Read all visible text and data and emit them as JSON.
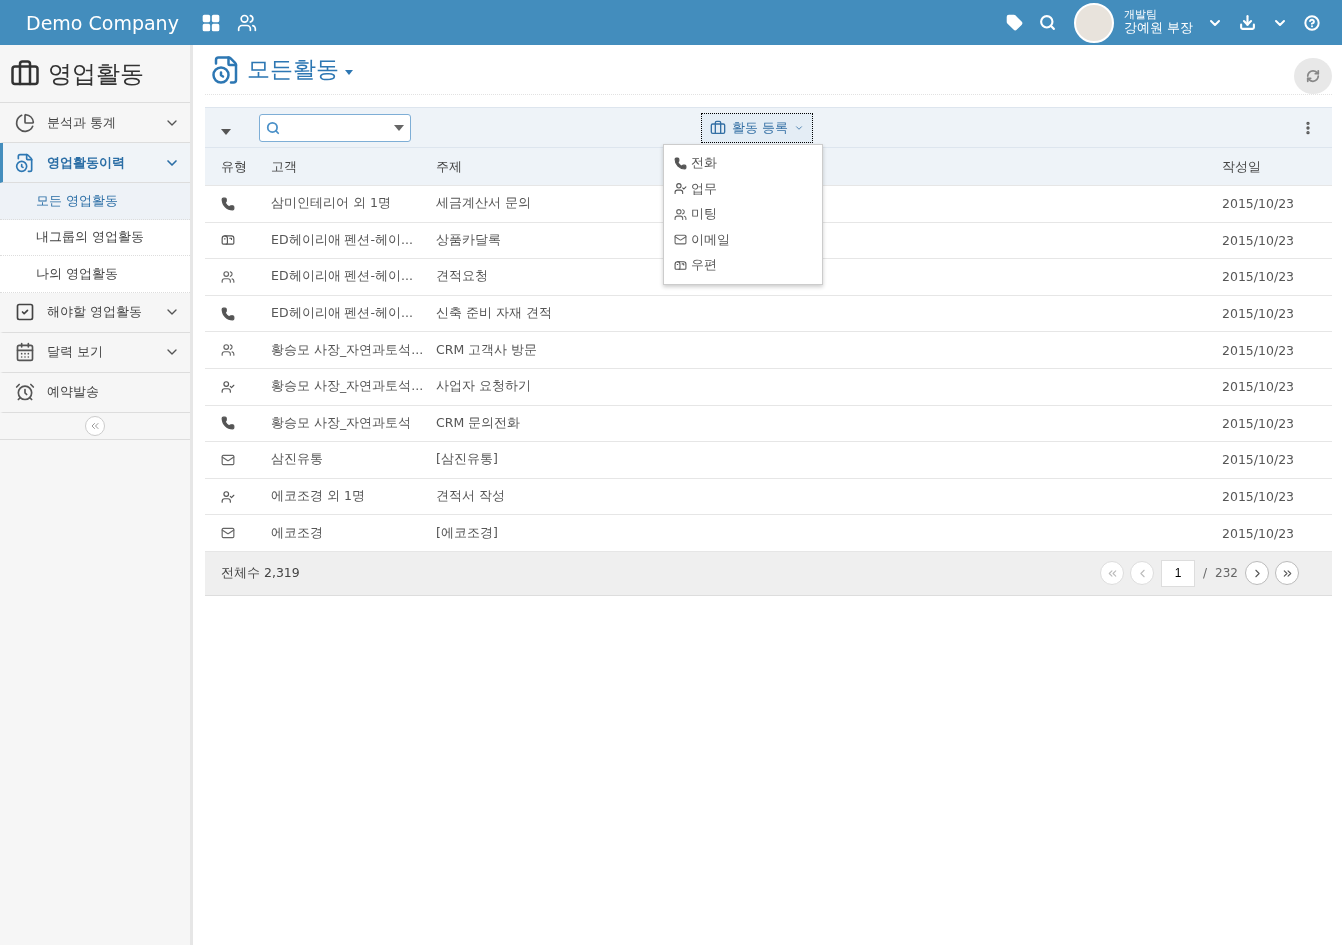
{
  "topbar": {
    "brand": "Demo Company",
    "user": {
      "team": "개발팀",
      "name": "강예원 부장"
    }
  },
  "sidebar": {
    "title": "영업활동",
    "items": [
      {
        "kind": "pie",
        "label": "분석과 통계",
        "selected": false,
        "expanded": false
      },
      {
        "kind": "history",
        "label": "영업활동이력",
        "selected": true,
        "expanded": true,
        "children": [
          {
            "label": "모든 영업활동",
            "selected": true
          },
          {
            "label": "내그룹의 영업활동",
            "selected": false
          },
          {
            "label": "나의 영업활동",
            "selected": false
          }
        ]
      },
      {
        "kind": "todo",
        "label": "해야할 영업활동",
        "selected": false,
        "expanded": false
      },
      {
        "kind": "calendar",
        "label": "달력 보기",
        "selected": false,
        "expanded": false
      },
      {
        "kind": "alarm",
        "label": "예약발송",
        "selected": false
      }
    ]
  },
  "page": {
    "title": "모든활동"
  },
  "toolbar": {
    "register_button": "활동 등록",
    "menu": [
      {
        "kind": "phone",
        "label": "전화"
      },
      {
        "kind": "task",
        "label": "업무"
      },
      {
        "kind": "meeting",
        "label": "미팅"
      },
      {
        "kind": "email",
        "label": "이메일"
      },
      {
        "kind": "post",
        "label": "우편"
      }
    ]
  },
  "table": {
    "columns": [
      "유형",
      "고객",
      "주제",
      "작성일"
    ],
    "rows": [
      {
        "kind": "phone",
        "customer": "삼미인테리어 외 1명",
        "subject": "세금계산서 문의",
        "date": "2015/10/23"
      },
      {
        "kind": "post",
        "customer": "ED헤이리애 펜션-헤이...",
        "subject": "상품카달록",
        "date": "2015/10/23"
      },
      {
        "kind": "meeting",
        "customer": "ED헤이리애 펜션-헤이...",
        "subject": "견적요청",
        "date": "2015/10/23"
      },
      {
        "kind": "phone",
        "customer": "ED헤이리애 펜션-헤이...",
        "subject": "신축 준비 자재 견적",
        "date": "2015/10/23"
      },
      {
        "kind": "meeting",
        "customer": "황승모 사장_자연과토석...",
        "subject": "CRM 고객사 방문",
        "date": "2015/10/23"
      },
      {
        "kind": "task",
        "customer": "황승모 사장_자연과토석...",
        "subject": "사업자 요청하기",
        "date": "2015/10/23"
      },
      {
        "kind": "phone",
        "customer": "황승모 사장_자연과토석",
        "subject": "CRM 문의전화",
        "date": "2015/10/23"
      },
      {
        "kind": "email",
        "customer": "삼진유통",
        "subject": "[삼진유통]",
        "date": "2015/10/23"
      },
      {
        "kind": "task",
        "customer": "에코조경 외 1명",
        "subject": "견적서 작성",
        "date": "2015/10/23"
      },
      {
        "kind": "email",
        "customer": "에코조경",
        "subject": "[에코조경]",
        "date": "2015/10/23"
      }
    ]
  },
  "footer": {
    "total": "전체수 2,319",
    "page": "1",
    "separator": "/",
    "pages": "232",
    "first_disabled": true,
    "prev_disabled": true,
    "next_disabled": false,
    "last_disabled": false
  }
}
